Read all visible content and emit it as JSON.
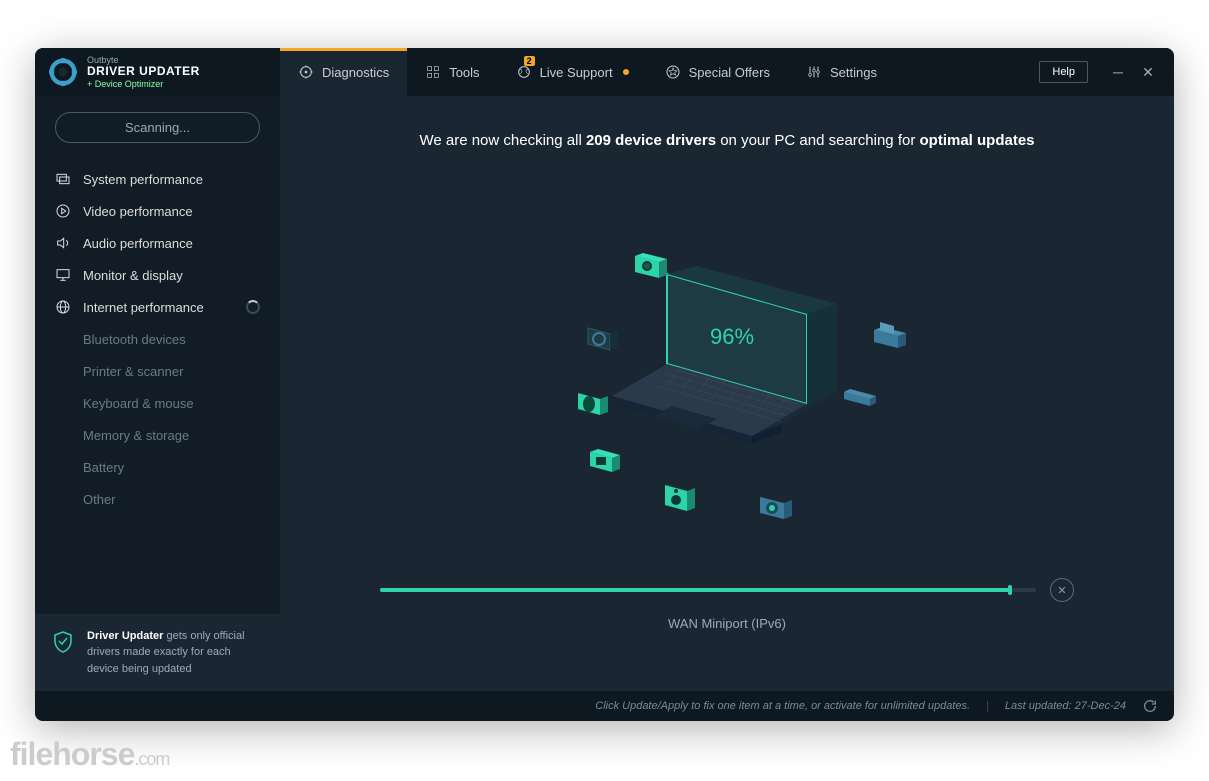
{
  "brand": {
    "company": "Outbyte",
    "product": "DRIVER UPDATER",
    "sub": "+ Device Optimizer"
  },
  "tabs": [
    {
      "id": "diagnostics",
      "label": "Diagnostics",
      "active": true
    },
    {
      "id": "tools",
      "label": "Tools"
    },
    {
      "id": "live-support",
      "label": "Live Support",
      "badge": "2",
      "dot": true
    },
    {
      "id": "special-offers",
      "label": "Special Offers"
    },
    {
      "id": "settings",
      "label": "Settings"
    }
  ],
  "help": "Help",
  "scanning": "Scanning...",
  "categories": [
    {
      "id": "system",
      "label": "System performance",
      "state": "done"
    },
    {
      "id": "video",
      "label": "Video performance",
      "state": "done"
    },
    {
      "id": "audio",
      "label": "Audio performance",
      "state": "done"
    },
    {
      "id": "monitor",
      "label": "Monitor & display",
      "state": "done"
    },
    {
      "id": "internet",
      "label": "Internet performance",
      "state": "scanning"
    },
    {
      "id": "bluetooth",
      "label": "Bluetooth devices",
      "state": "pending"
    },
    {
      "id": "printer",
      "label": "Printer & scanner",
      "state": "pending"
    },
    {
      "id": "keyboard",
      "label": "Keyboard & mouse",
      "state": "pending"
    },
    {
      "id": "memory",
      "label": "Memory & storage",
      "state": "pending"
    },
    {
      "id": "battery",
      "label": "Battery",
      "state": "pending"
    },
    {
      "id": "other",
      "label": "Other",
      "state": "pending"
    }
  ],
  "promo": {
    "bold": "Driver Updater",
    "rest": " gets only official drivers made exactly for each device being updated"
  },
  "headline": {
    "pre": "We are now checking all ",
    "count": "209 device drivers",
    "mid": " on your PC and searching for ",
    "post": "optimal updates"
  },
  "progress": {
    "percent": 96,
    "current": "WAN Miniport (IPv6)"
  },
  "status": {
    "hint": "Click Update/Apply to fix one item at a time, or activate for unlimited updates.",
    "updated_label": "Last updated:",
    "updated_value": "27-Dec-24"
  },
  "colors": {
    "accent": "#2dd4aa",
    "orange": "#f5a623"
  }
}
